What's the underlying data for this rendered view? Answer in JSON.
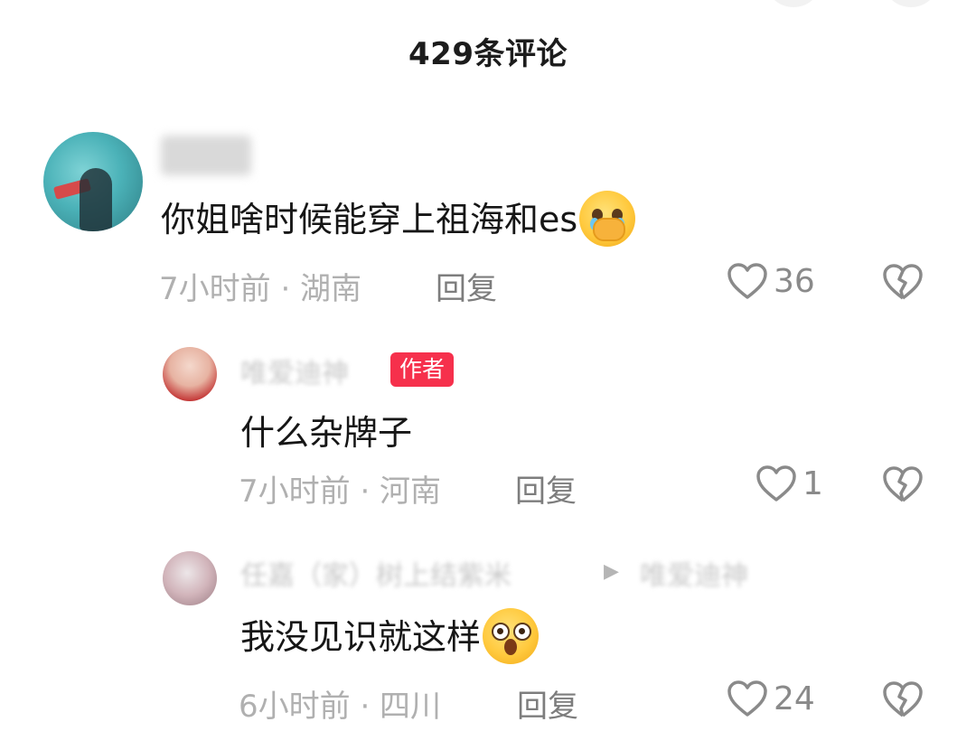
{
  "header": {
    "title": "429条评论"
  },
  "comments": [
    {
      "text": "你姐啥时候能穿上祖海和es",
      "emoji": "pleading-hands-over-mouth-emoji",
      "time_location": "7小时前 · 湖南",
      "reply_label": "回复",
      "likes": "36"
    },
    {
      "name": "唯爱迪神",
      "badge": "作者",
      "text": "什么杂牌子",
      "time_location": "7小时前 · 河南",
      "reply_label": "回复",
      "likes": "1"
    },
    {
      "name": "任嘉（家）树上结紫米",
      "reply_to": "唯爱迪神",
      "text": "我没见识就这样",
      "emoji": "astonished-face-emoji",
      "time_location": "6小时前 · 四川",
      "reply_label": "回复",
      "likes": "24"
    }
  ],
  "colors": {
    "badge": "#f6304c",
    "meta_text": "#b0b0b0",
    "reply_text": "#7d7d7d",
    "main_text": "#161616"
  }
}
